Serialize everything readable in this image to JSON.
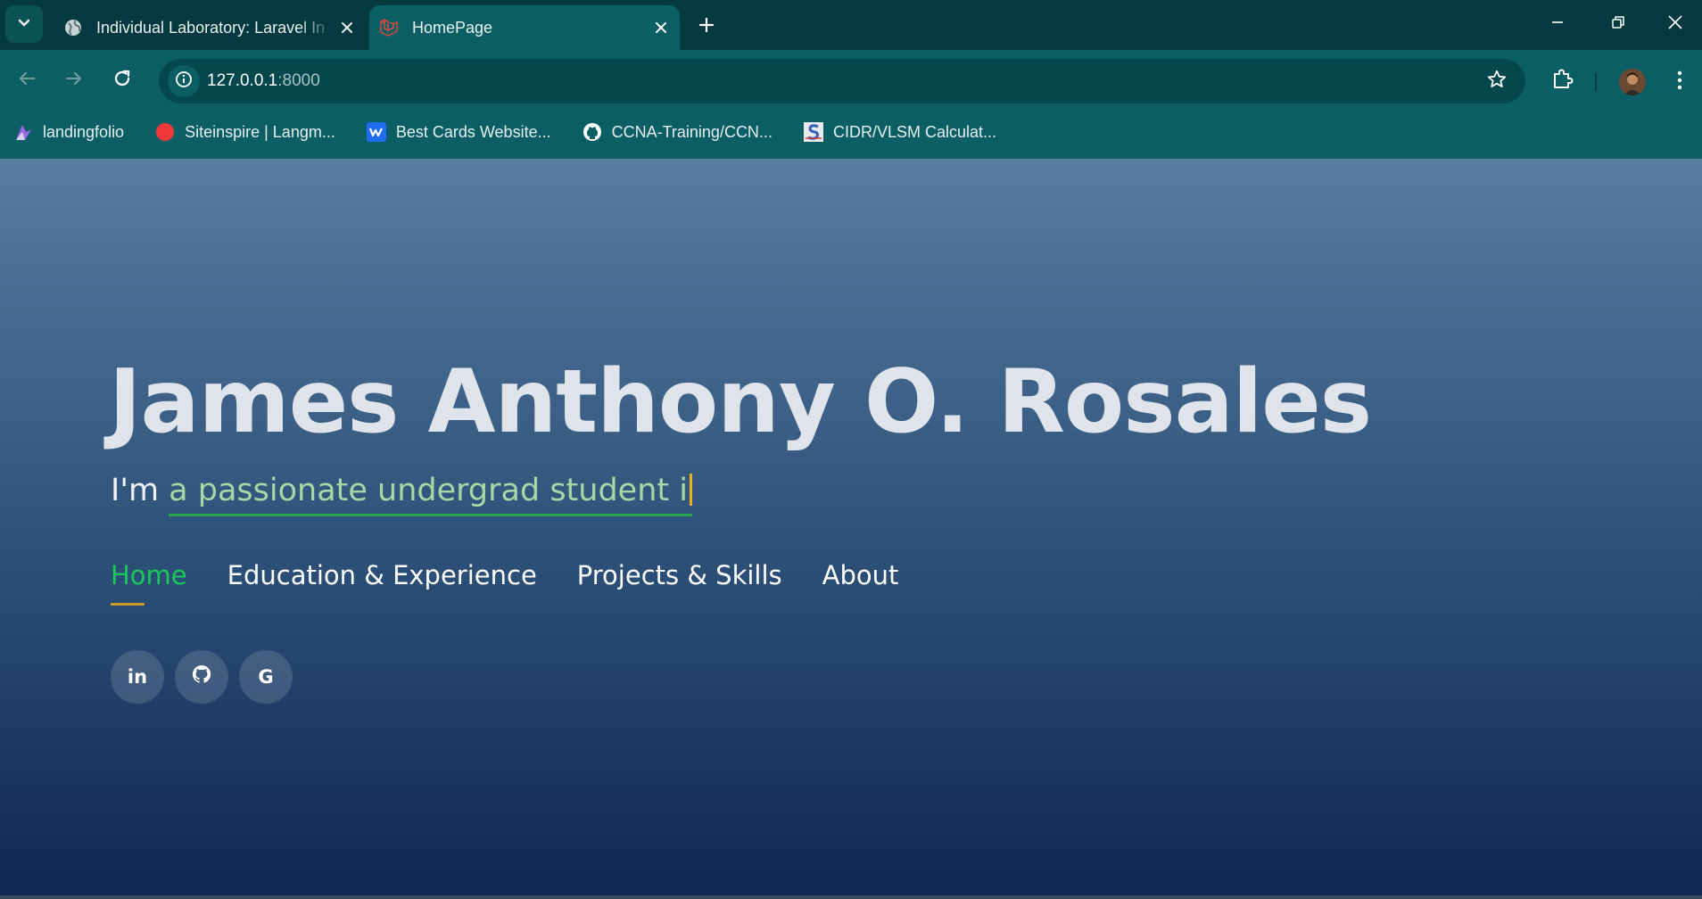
{
  "browser": {
    "tabs": [
      {
        "title": "Individual Laboratory: Laravel In",
        "favicon": "globe-icon",
        "active": false
      },
      {
        "title": "HomePage",
        "favicon": "laravel-icon",
        "active": true
      }
    ],
    "address": {
      "host": "127.0.0.1",
      "port": ":8000"
    },
    "bookmarks": [
      {
        "label": "landingfolio",
        "icon": "landingfolio-icon"
      },
      {
        "label": "Siteinspire | Langm...",
        "icon": "siteinspire-icon"
      },
      {
        "label": "Best Cards Website...",
        "icon": "webflow-icon"
      },
      {
        "label": "CCNA-Training/CCN...",
        "icon": "github-icon"
      },
      {
        "label": "CIDR/VLSM Calculat...",
        "icon": "cidr-icon"
      }
    ]
  },
  "page": {
    "hero_name": "James Anthony O. Rosales",
    "subtitle_prefix": "I'm ",
    "subtitle_typed": "a passionate undergrad student i",
    "nav": [
      {
        "label": "Home",
        "active": true
      },
      {
        "label": "Education & Experience",
        "active": false
      },
      {
        "label": "Projects & Skills",
        "active": false
      },
      {
        "label": "About",
        "active": false
      }
    ],
    "socials": [
      {
        "name": "linkedin",
        "glyph": "in"
      },
      {
        "name": "github",
        "glyph": ""
      },
      {
        "name": "google",
        "glyph": "G"
      }
    ],
    "colors": {
      "active_nav": "#18c95a",
      "typed_text": "#a7d7a5",
      "cursor": "#f2b01e",
      "chrome": "#0b5e63"
    }
  }
}
